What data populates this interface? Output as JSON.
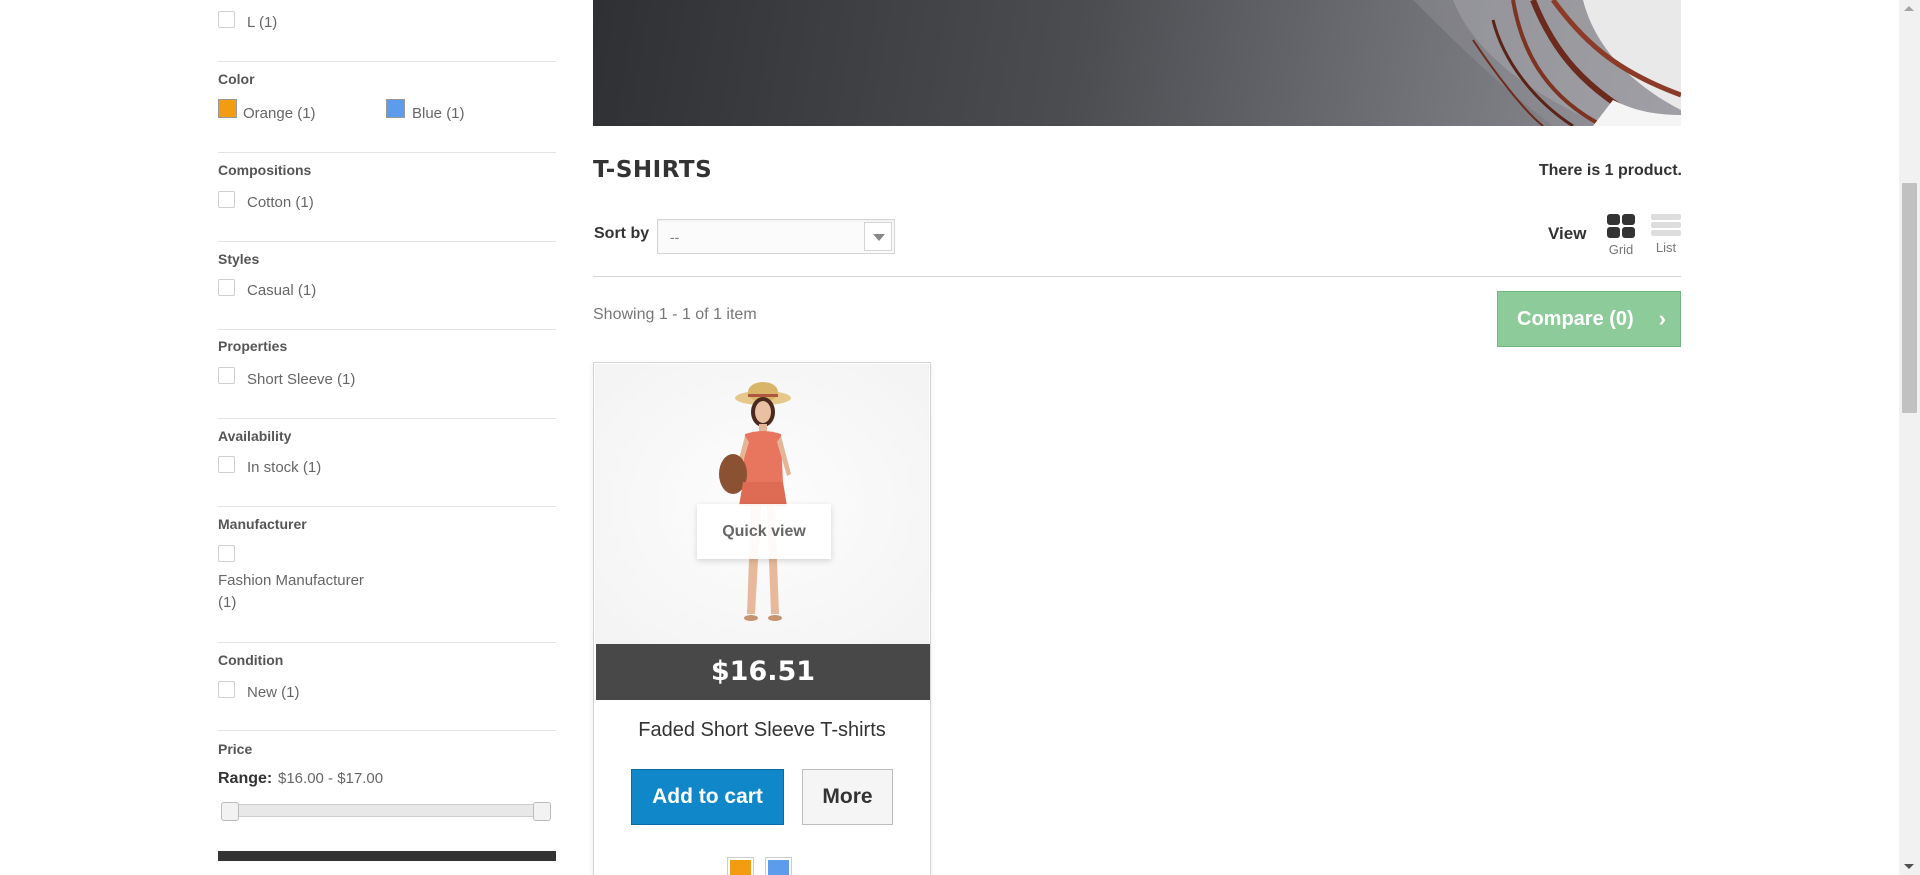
{
  "sidebar": {
    "size_option": "L (1)",
    "color": {
      "title": "Color",
      "options": [
        {
          "label": "Orange (1)",
          "swatch": "#f39c11"
        },
        {
          "label": "Blue (1)",
          "swatch": "#5d9cec"
        }
      ]
    },
    "compositions": {
      "title": "Compositions",
      "option": "Cotton (1)"
    },
    "styles": {
      "title": "Styles",
      "option": "Casual (1)"
    },
    "properties": {
      "title": "Properties",
      "option": "Short Sleeve (1)"
    },
    "availability": {
      "title": "Availability",
      "option": "In stock (1)"
    },
    "manufacturer": {
      "title": "Manufacturer",
      "option_line1": "Fashion Manufacturer",
      "option_line2": "(1)"
    },
    "condition": {
      "title": "Condition",
      "option": "New (1)"
    },
    "price": {
      "title": "Price",
      "range_label": "Range:",
      "range_value": "$16.00 - $17.00",
      "min": 16.0,
      "max": 17.0
    }
  },
  "category": {
    "title": "T-SHIRTS",
    "product_count": "There is 1 product."
  },
  "toolbar": {
    "sort_label": "Sort by",
    "sort_value": "--",
    "view_label": "View",
    "grid_label": "Grid",
    "list_label": "List",
    "showing": "Showing 1 - 1 of 1 item",
    "compare_label": "Compare (0)"
  },
  "product": {
    "quick_view": "Quick view",
    "price": "$16.51",
    "name": "Faded Short Sleeve T-shirts",
    "add_to_cart": "Add to cart",
    "more": "More",
    "colors": [
      "#f39c11",
      "#5d9cec"
    ]
  }
}
